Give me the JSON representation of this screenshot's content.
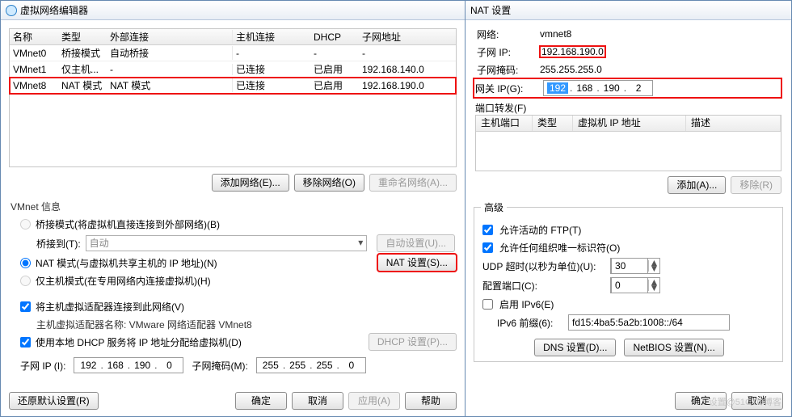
{
  "left": {
    "title": "虚拟网络编辑器",
    "table": {
      "headers": {
        "name": "名称",
        "type": "类型",
        "ext": "外部连接",
        "host": "主机连接",
        "dhcp": "DHCP",
        "sub": "子网地址"
      },
      "rows": [
        {
          "name": "VMnet0",
          "type": "桥接模式",
          "ext": "自动桥接",
          "host": "-",
          "dhcp": "-",
          "sub": "-"
        },
        {
          "name": "VMnet1",
          "type": "仅主机...",
          "ext": "-",
          "host": "已连接",
          "dhcp": "已启用",
          "sub": "192.168.140.0"
        },
        {
          "name": "VMnet8",
          "type": "NAT 模式",
          "ext": "NAT 模式",
          "host": "已连接",
          "dhcp": "已启用",
          "sub": "192.168.190.0"
        }
      ]
    },
    "btn_add_net": "添加网络(E)...",
    "btn_remove_net": "移除网络(O)",
    "btn_rename_net": "重命名网络(A)...",
    "group_vmnet": "VMnet 信息",
    "radio_bridge": "桥接模式(将虚拟机直接连接到外部网络)(B)",
    "lbl_bridge_to": "桥接到(T):",
    "bridge_auto": "自动",
    "btn_auto_set": "自动设置(U)...",
    "radio_nat": "NAT 模式(与虚拟机共享主机的 IP 地址)(N)",
    "btn_nat_set": "NAT 设置(S)...",
    "radio_host": "仅主机模式(在专用网络内连接虚拟机)(H)",
    "chk_connect_adapter": "将主机虚拟适配器连接到此网络(V)",
    "lbl_adapter_name": "主机虚拟适配器名称: VMware 网络适配器 VMnet8",
    "chk_dhcp": "使用本地 DHCP 服务将 IP 地址分配给虚拟机(D)",
    "btn_dhcp_set": "DHCP 设置(P)...",
    "lbl_subnet_ip": "子网 IP (I):",
    "subnet_ip": [
      "192",
      "168",
      "190",
      "0"
    ],
    "lbl_subnet_mask": "子网掩码(M):",
    "subnet_mask": [
      "255",
      "255",
      "255",
      "0"
    ],
    "btn_restore": "还原默认设置(R)",
    "btn_ok": "确定",
    "btn_cancel": "取消",
    "btn_apply": "应用(A)",
    "btn_help": "帮助"
  },
  "right": {
    "title": "NAT 设置",
    "lbl_net": "网络:",
    "net": "vmnet8",
    "lbl_sub_ip": "子网 IP:",
    "sub_ip": "192.168.190.0",
    "lbl_sub_mask": "子网掩码:",
    "sub_mask": "255.255.255.0",
    "lbl_gateway": "网关 IP(G):",
    "gw_seg": [
      "192",
      "168",
      "190",
      "2"
    ],
    "lbl_port_fwd": "端口转发(F)",
    "pf_headers": {
      "host_port": "主机端口",
      "type": "类型",
      "vm_ip": "虚拟机 IP 地址",
      "desc": "描述"
    },
    "btn_add": "添加(A)...",
    "btn_remove": "移除(R)",
    "group_adv": "高级",
    "chk_ftp": "允许活动的 FTP(T)",
    "chk_udp": "允许任何组织唯一标识符(O)",
    "lbl_udp_timeout": "UDP 超时(以秒为单位)(U):",
    "udp_timeout": "30",
    "lbl_cfg_port": "配置端口(C):",
    "cfg_port": "0",
    "chk_ipv6": "启用 IPv6(E)",
    "lbl_ipv6_prefix": "IPv6 前缀(6):",
    "ipv6_prefix": "fd15:4ba5:5a2b:1008::/64",
    "btn_dns": "DNS 设置(D)...",
    "btn_netbios": "NetBIOS 设置(N)...",
    "btn_ok": "确定",
    "btn_cancel": "取消",
    "branding": "设置@51CTO博客"
  }
}
